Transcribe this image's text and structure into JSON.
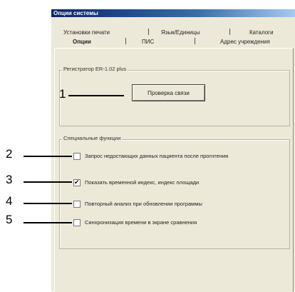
{
  "window": {
    "title": "Опции системы"
  },
  "tabs_back": [
    {
      "label": "Установки печати"
    },
    {
      "label": "Язык/Единицы"
    },
    {
      "label": "Каталоги"
    }
  ],
  "tabs_front": [
    {
      "label": "Опции"
    },
    {
      "label": "ПИС"
    },
    {
      "label": "Адрес учреждения"
    }
  ],
  "registrar_group": {
    "label": "Регистратор ER-1.02 plus",
    "check_button_label": "Проверка связи"
  },
  "special_group": {
    "label": "Специальные функции",
    "options": [
      {
        "label": "Запрос недостающих данных пациента после прогнтения",
        "checked": false
      },
      {
        "label": "Показать временной индекс, индекс площади",
        "checked": true
      },
      {
        "label": "Повторный анализ при обновлении программы",
        "checked": false
      },
      {
        "label": "Синхронизация времени в экране сравнения",
        "checked": false
      }
    ]
  },
  "callouts": [
    "1",
    "2",
    "3",
    "4",
    "5"
  ]
}
